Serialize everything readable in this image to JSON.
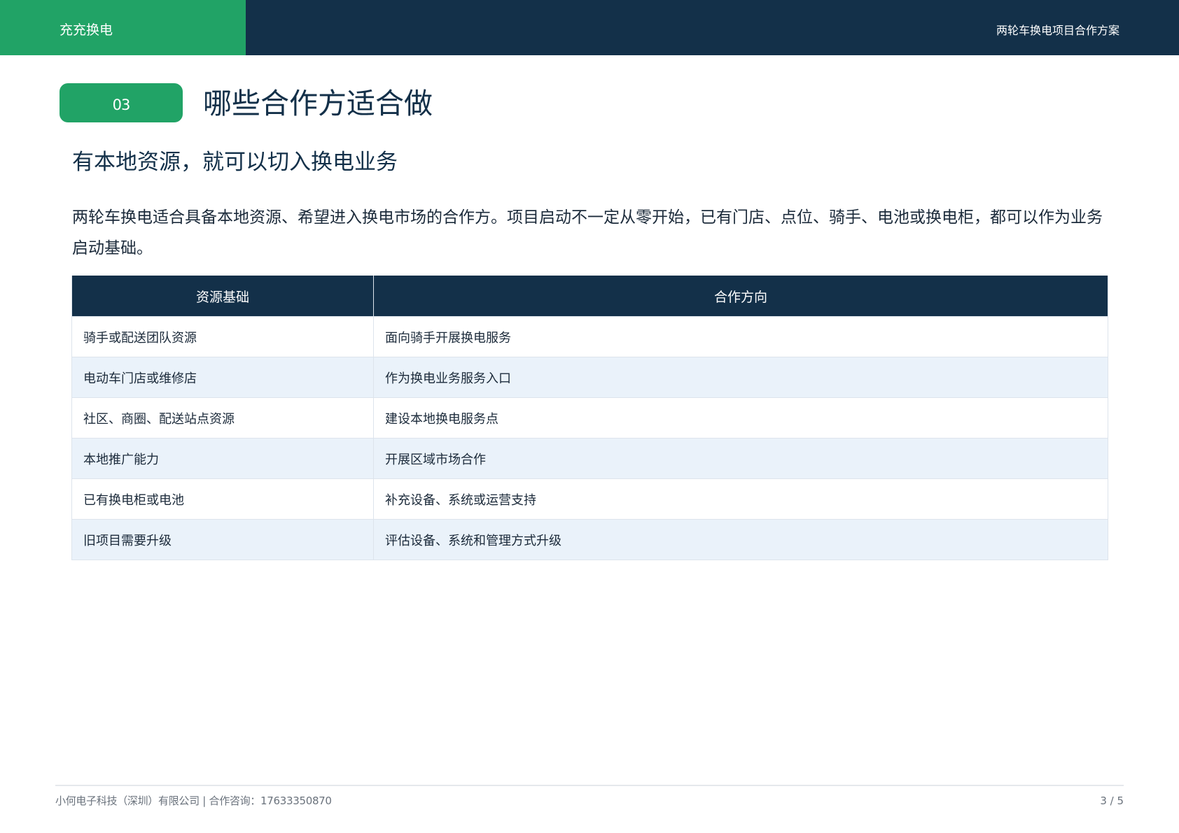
{
  "header": {
    "brand": "充充换电",
    "doc_title": "两轮车换电项目合作方案"
  },
  "section": {
    "number": "03",
    "title": "哪些合作方适合做"
  },
  "subtitle": "有本地资源，就可以切入换电业务",
  "intro": "两轮车换电适合具备本地资源、希望进入换电市场的合作方。项目启动不一定从零开始，已有门店、点位、骑手、电池或换电柜，都可以作为业务启动基础。",
  "table": {
    "headers": [
      "资源基础",
      "合作方向"
    ],
    "rows": [
      [
        "骑手或配送团队资源",
        "面向骑手开展换电服务"
      ],
      [
        "电动车门店或维修店",
        "作为换电业务服务入口"
      ],
      [
        "社区、商圈、配送站点资源",
        "建设本地换电服务点"
      ],
      [
        "本地推广能力",
        "开展区域市场合作"
      ],
      [
        "已有换电柜或电池",
        "补充设备、系统或运营支持"
      ],
      [
        "旧项目需要升级",
        "评估设备、系统和管理方式升级"
      ]
    ]
  },
  "footer": {
    "company": "小何电子科技（深圳）有限公司 | 合作咨询：17633350870",
    "page": "3 / 5"
  },
  "colors": {
    "brand_green": "#21a366",
    "navy": "#133049",
    "row_alt": "#eaf2fa"
  }
}
